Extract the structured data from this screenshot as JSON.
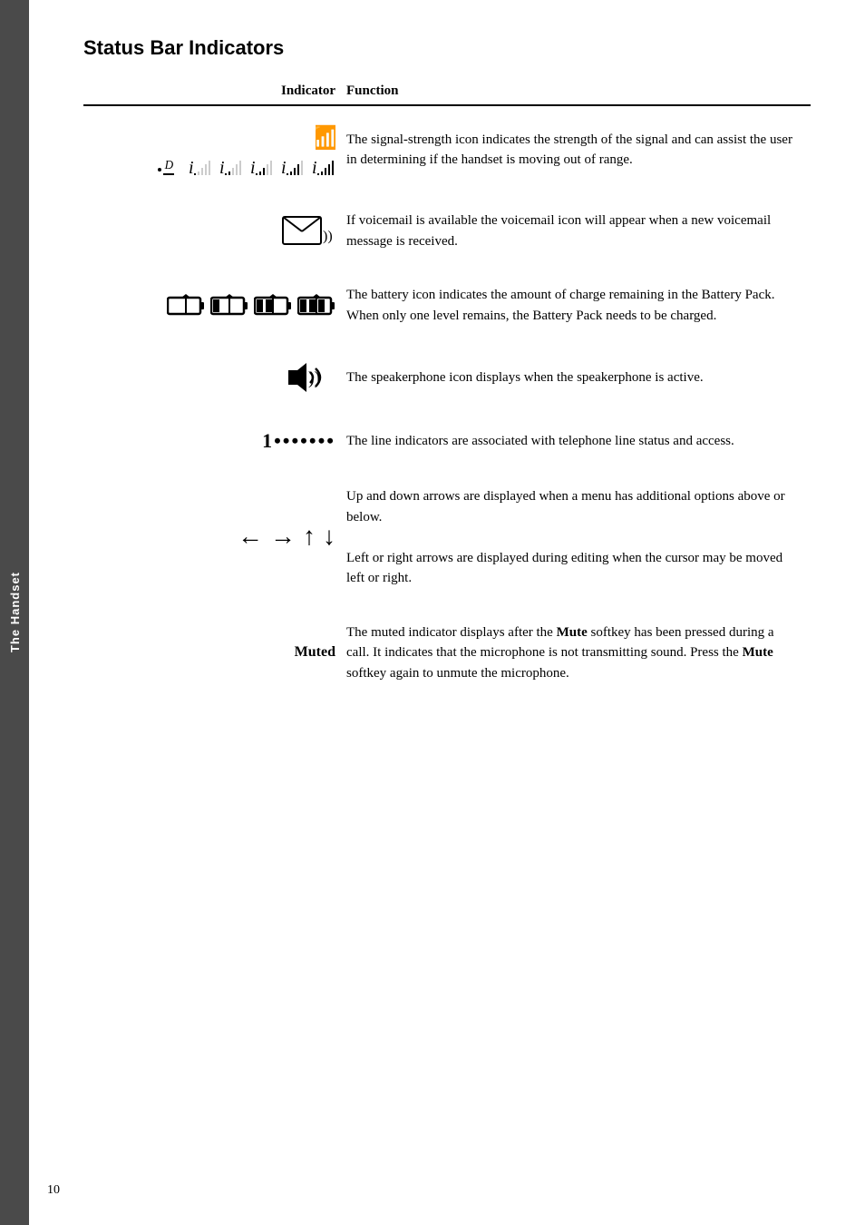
{
  "sidebar": {
    "label": "The Handset"
  },
  "page": {
    "title": "Status Bar Indicators",
    "number": "10"
  },
  "table": {
    "headers": {
      "indicator": "Indicator",
      "function": "Function"
    },
    "rows": [
      {
        "indicator_type": "signal",
        "function_text": "The signal-strength icon indicates the strength of the signal and can assist the user in determining if the handset is moving out of range."
      },
      {
        "indicator_type": "voicemail",
        "function_text": "If voicemail is available the voicemail icon will appear when a new voicemail message is received."
      },
      {
        "indicator_type": "battery",
        "function_text": "The battery icon indicates the amount of charge remaining in the Battery Pack. When only one level remains, the Battery Pack needs to be charged."
      },
      {
        "indicator_type": "speakerphone",
        "function_text": "The speakerphone icon displays when the speakerphone is active."
      },
      {
        "indicator_type": "line",
        "function_text": "The line indicators are associated with telephone line status and access."
      },
      {
        "indicator_type": "arrows",
        "function_text_1": "Up and down arrows are displayed when a menu has additional options above or below.",
        "function_text_2": "Left or right arrows are displayed during editing when the cursor may be moved left or right."
      },
      {
        "indicator_type": "muted",
        "indicator_label": "Muted",
        "function_text_parts": [
          {
            "text": "The muted indicator displays after the ",
            "bold": false
          },
          {
            "text": "Mute",
            "bold": true
          },
          {
            "text": " softkey has been pressed during a call. It indicates that the microphone is not transmitting sound. Press the ",
            "bold": false
          },
          {
            "text": "Mute",
            "bold": true
          },
          {
            "text": " softkey again to unmute the microphone.",
            "bold": false
          }
        ]
      }
    ]
  }
}
